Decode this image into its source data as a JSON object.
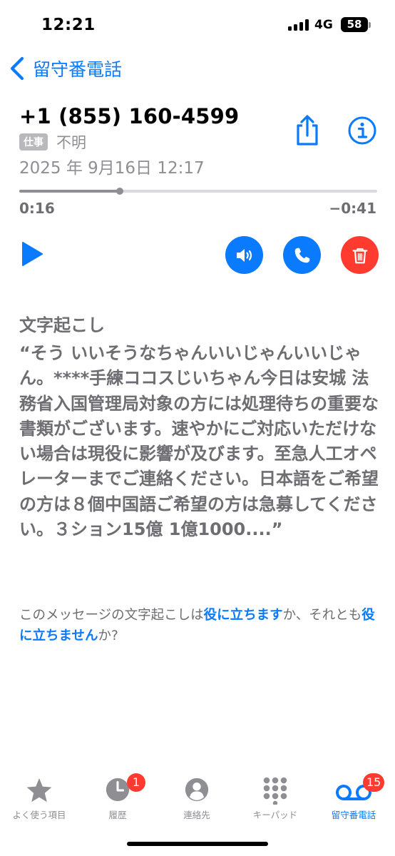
{
  "status_bar": {
    "time": "12:21",
    "network": "4G",
    "battery": "58"
  },
  "nav": {
    "back_label": "留守番電話",
    "back_icon": "chevron-left-icon"
  },
  "voicemail": {
    "phone_number": "+1 (855) 160-4599",
    "tag": "仕事",
    "location": "不明",
    "date": "2025 年 9月16日 12:17",
    "elapsed": "0:16",
    "remaining": "−0:41",
    "progress": 0.28
  },
  "actions": {
    "share": "share-icon",
    "info": "info-icon",
    "play": "play-icon",
    "speaker": "speaker-icon",
    "call": "phone-icon",
    "delete": "trash-icon"
  },
  "transcript": {
    "title": "文字起こし",
    "body": "“そう いいそうなちゃんいいじゃんいいじゃん。****手練ココスじいちゃん今日は安城 法務省入国管理局対象の方には処理待ちの重要な書類がございます。速やかにご対応いただけない場合は現役に影響が及びます。至急人工オペレーターまでご連絡ください。日本語をご希望の方は８個中国語ご希望の方は急募してください。３ション15億 1億1000....”"
  },
  "feedback": {
    "prefix": "このメッセージの文字起こしは",
    "useful": "役に立ちます",
    "middle": "か、それとも",
    "not_useful": "役に立ちません",
    "suffix": "か?"
  },
  "tab_bar": {
    "tabs": [
      {
        "label": "よく使う項目",
        "icon": "star-icon"
      },
      {
        "label": "履歴",
        "icon": "clock-icon",
        "badge": "1"
      },
      {
        "label": "連絡先",
        "icon": "person-icon"
      },
      {
        "label": "キーパッド",
        "icon": "keypad-icon"
      },
      {
        "label": "留守番電話",
        "icon": "voicemail-icon",
        "badge": "15"
      }
    ]
  },
  "colors": {
    "accent": "#0a7aff",
    "destructive": "#ff3b30",
    "secondary_text": "#6d6d72"
  }
}
